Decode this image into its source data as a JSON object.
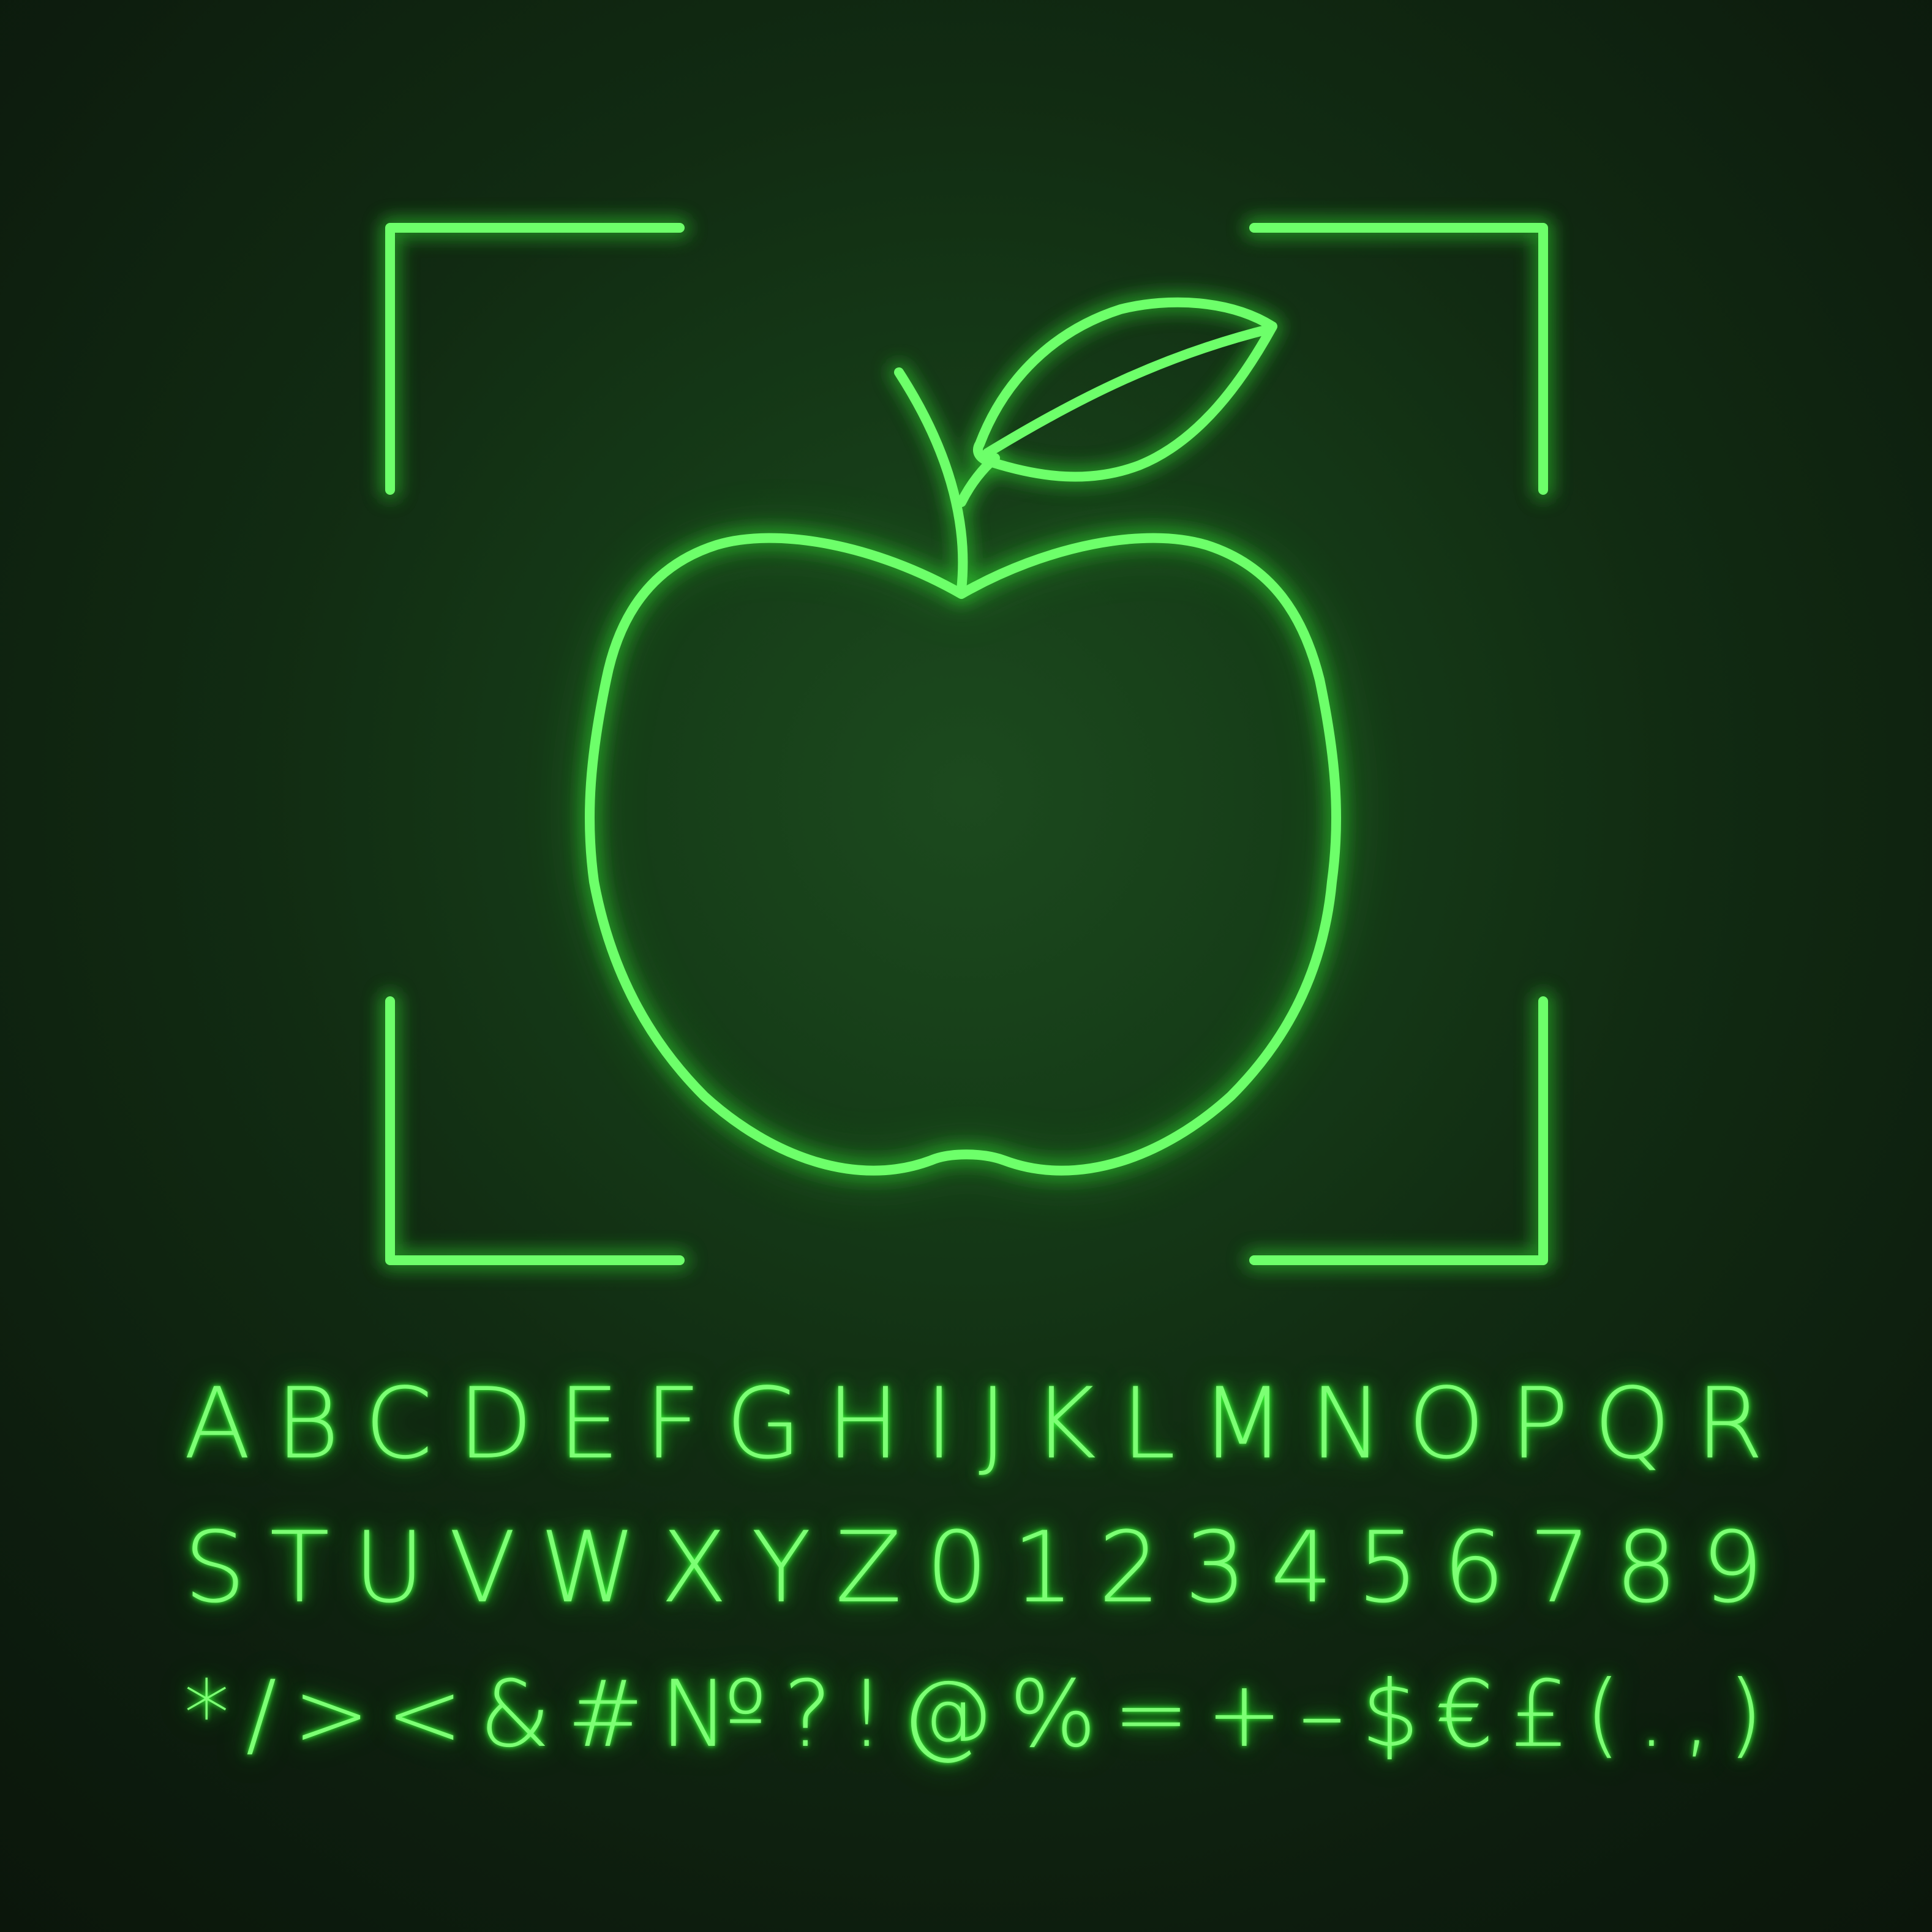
{
  "colors": {
    "background": "#112b12",
    "neon": "#6dff6a",
    "glow": "#2fd62f"
  },
  "icon": {
    "name": "apple-icon",
    "frame": "focus-frame-corners"
  },
  "alphabet": {
    "row1": [
      "A",
      "B",
      "C",
      "D",
      "E",
      "F",
      "G",
      "H",
      "I",
      "J",
      "K",
      "L",
      "M",
      "N",
      "O",
      "P",
      "Q",
      "R"
    ],
    "row2": [
      "S",
      "T",
      "U",
      "V",
      "W",
      "X",
      "Y",
      "Z",
      "0",
      "1",
      "2",
      "3",
      "4",
      "5",
      "6",
      "7",
      "8",
      "9"
    ],
    "row3": [
      "*",
      "/",
      ">",
      "<",
      "&",
      "#",
      "№",
      "?",
      "!",
      "@",
      "%",
      "=",
      "+",
      "–",
      "$",
      "€",
      "£",
      "(",
      ".",
      ",",
      ")"
    ]
  }
}
